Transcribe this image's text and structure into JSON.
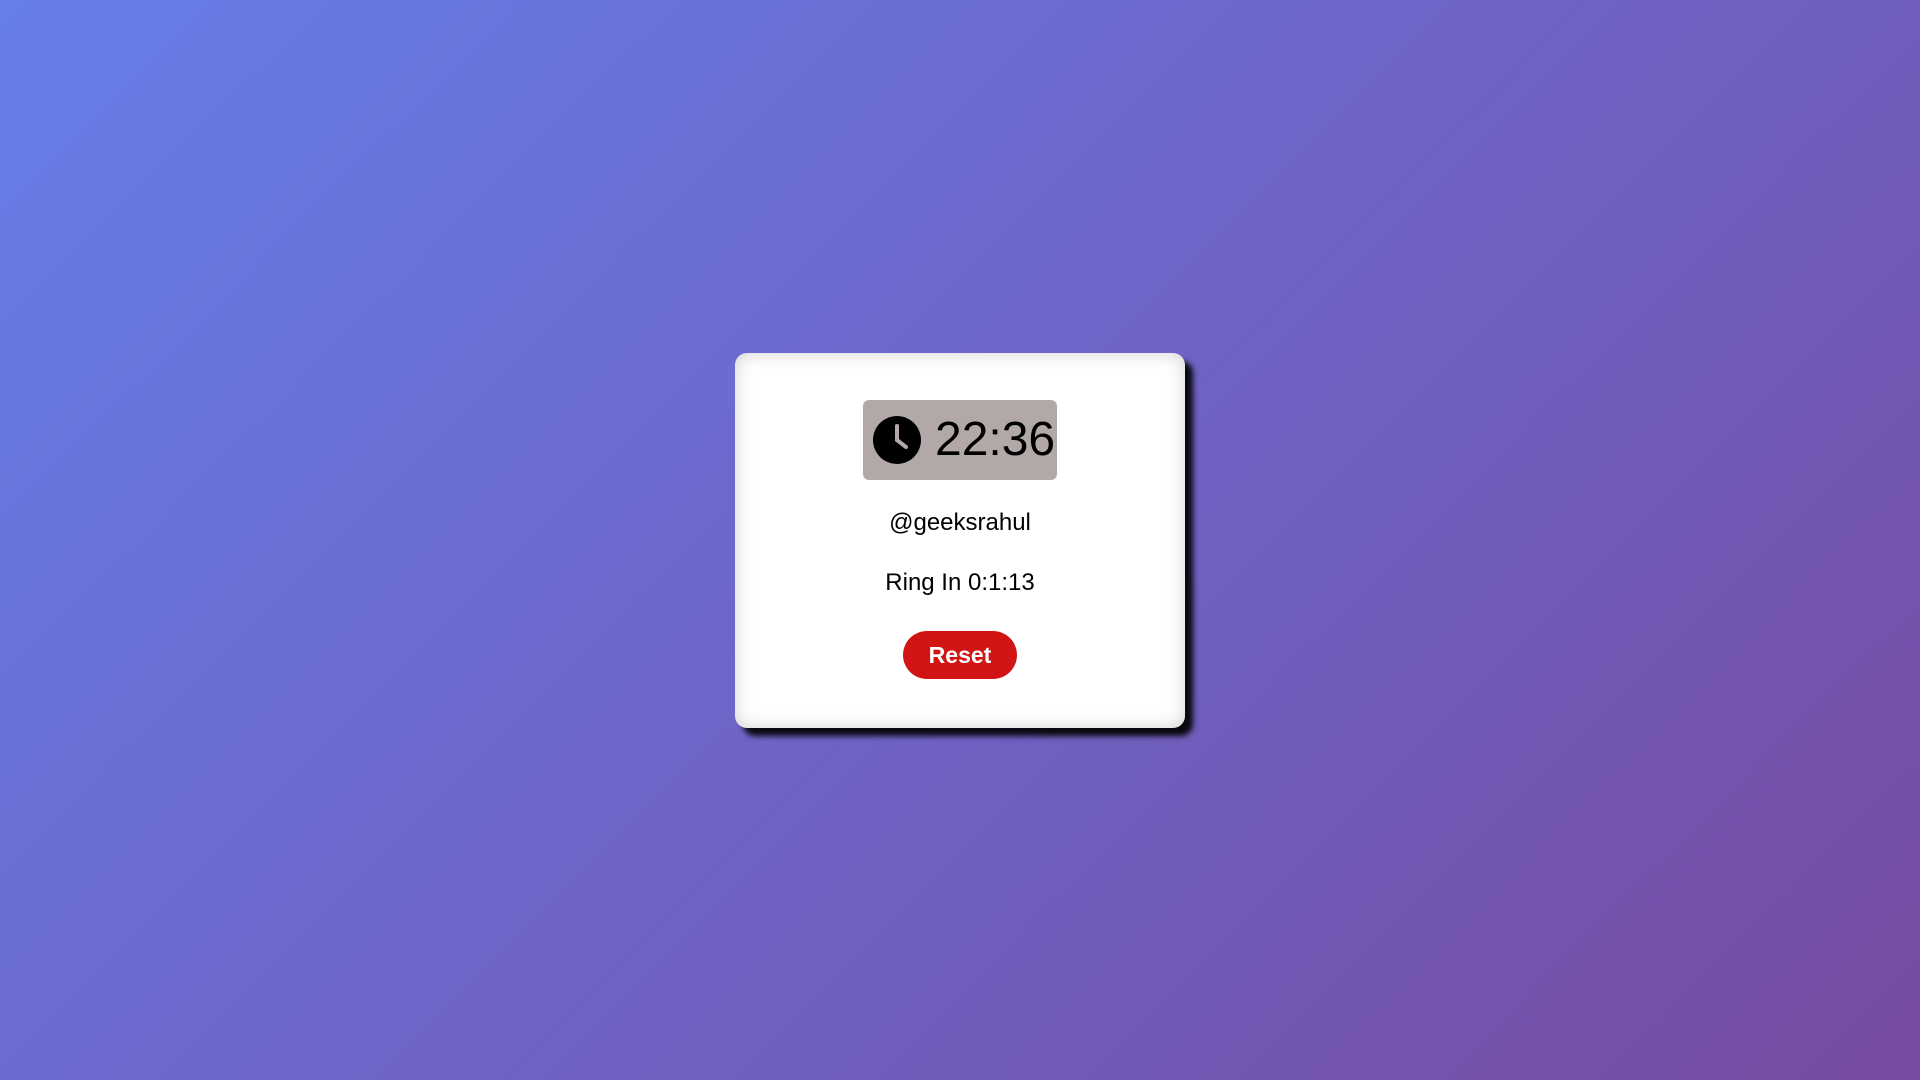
{
  "clock": {
    "time": "22:36",
    "icon": "clock-icon"
  },
  "handle": "@geeksrahul",
  "alarm": {
    "ring_text": "Ring In 0:1:13"
  },
  "actions": {
    "reset_label": "Reset"
  },
  "colors": {
    "background_gradient": [
      "#667eea",
      "#764ba2"
    ],
    "card": "#ffffff",
    "clock_box": "#b3a8a8",
    "reset_button": "#d11515"
  }
}
